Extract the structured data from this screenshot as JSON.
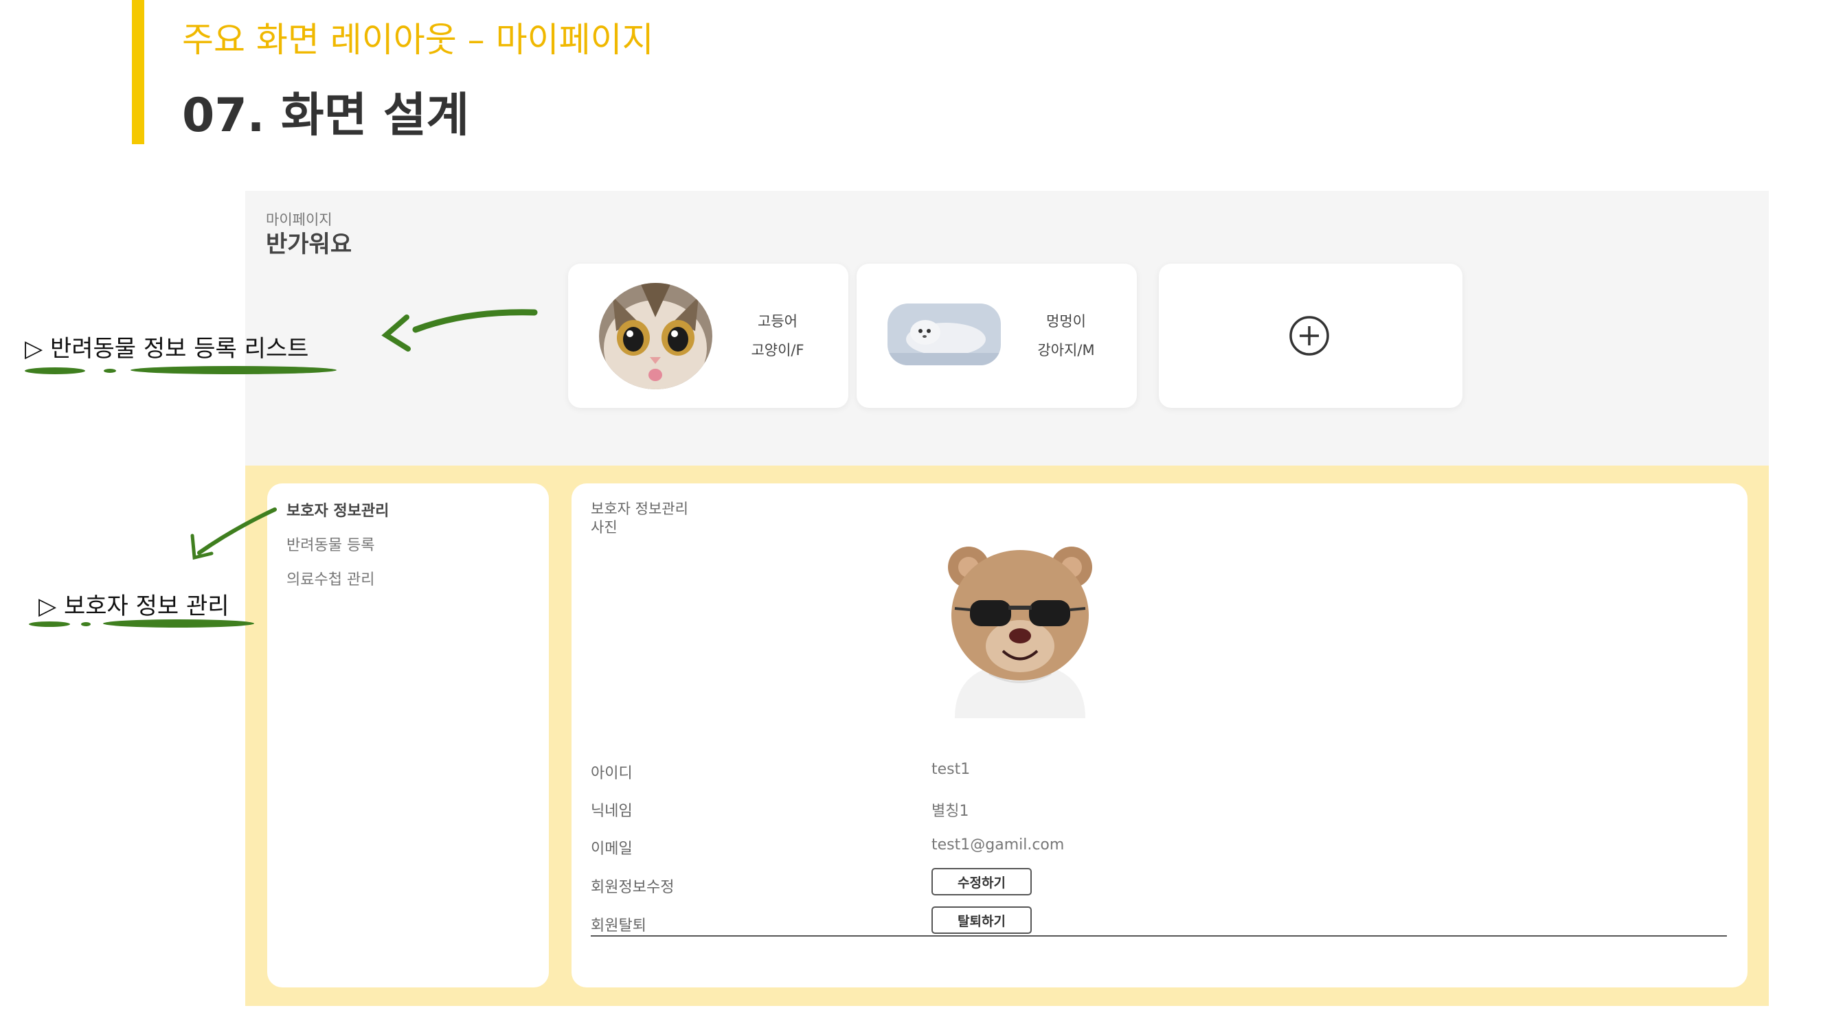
{
  "slide": {
    "subtitle": "주요 화면 레이아웃 – 마이페이지",
    "title": "07. 화면 설계",
    "accent_color": "#f5c800"
  },
  "mypage": {
    "label_small": "마이페이지",
    "greeting": "반가워요",
    "pets": [
      {
        "name": "고등어",
        "info": "고양이/F",
        "photo": "cat-photo"
      },
      {
        "name": "멍멍이",
        "info": "강아지/M",
        "photo": "seal-photo"
      }
    ],
    "add_pet_icon": "plus-circle-icon"
  },
  "sidebar": {
    "items": [
      {
        "label": "보호자 정보관리",
        "active": true
      },
      {
        "label": "반려동물 등록",
        "active": false
      },
      {
        "label": "의료수첩 관리",
        "active": false
      }
    ]
  },
  "guardian": {
    "section_title": "보호자 정보관리",
    "photo_label": "사진",
    "photo": "teddy-bear-sunglasses-photo",
    "fields": [
      {
        "label": "아이디",
        "value": "test1"
      },
      {
        "label": "닉네임",
        "value": "별칭1"
      },
      {
        "label": "이메일",
        "value": "test1@gamil.com"
      }
    ],
    "edit_label": "회원정보수정",
    "edit_button": "수정하기",
    "withdraw_label": "회원탈퇴",
    "withdraw_button": "탈퇴하기"
  },
  "annotations": {
    "pet_list": "▷ 반려동물 정보 등록 리스트",
    "guardian_info": "▷ 보호자 정보 관리",
    "marker_color": "#3f7f1f"
  },
  "colors": {
    "panel_yellow": "#fdecb1",
    "screen_gray": "#f5f5f5"
  }
}
